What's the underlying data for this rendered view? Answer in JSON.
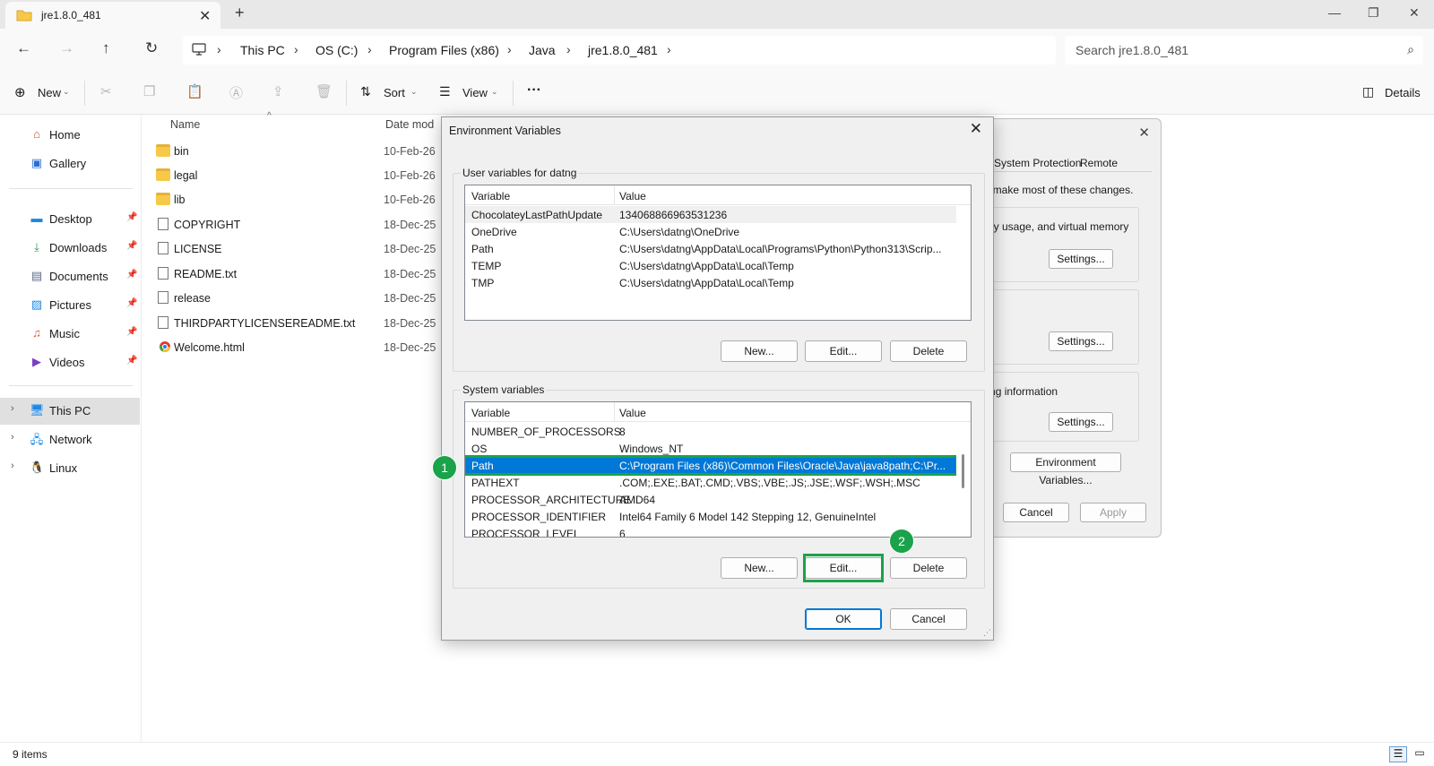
{
  "explorer": {
    "tab_title": "jre1.8.0_481",
    "breadcrumbs": [
      "This PC",
      "OS (C:)",
      "Program Files (x86)",
      "Java",
      "jre1.8.0_481"
    ],
    "search_placeholder": "Search jre1.8.0_481",
    "commands": {
      "new": "New",
      "sort": "Sort",
      "view": "View",
      "more": "···",
      "details": "Details"
    },
    "sidebar": {
      "top": [
        {
          "label": "Home",
          "icon": "home-icon"
        },
        {
          "label": "Gallery",
          "icon": "gallery-icon"
        }
      ],
      "pinned": [
        {
          "label": "Desktop",
          "icon": "desktop-icon"
        },
        {
          "label": "Downloads",
          "icon": "downloads-icon"
        },
        {
          "label": "Documents",
          "icon": "documents-icon"
        },
        {
          "label": "Pictures",
          "icon": "pictures-icon"
        },
        {
          "label": "Music",
          "icon": "music-icon"
        },
        {
          "label": "Videos",
          "icon": "videos-icon"
        }
      ],
      "drives": [
        {
          "label": "This PC",
          "icon": "this-pc-icon"
        },
        {
          "label": "Network",
          "icon": "network-icon"
        },
        {
          "label": "Linux",
          "icon": "linux-icon"
        }
      ]
    },
    "columns": {
      "name": "Name",
      "date": "Date mod"
    },
    "files": [
      {
        "name": "bin",
        "date": "10-Feb-26",
        "type": "folder"
      },
      {
        "name": "legal",
        "date": "10-Feb-26",
        "type": "folder"
      },
      {
        "name": "lib",
        "date": "10-Feb-26",
        "type": "folder"
      },
      {
        "name": "COPYRIGHT",
        "date": "18-Dec-25",
        "type": "file"
      },
      {
        "name": "LICENSE",
        "date": "18-Dec-25",
        "type": "file"
      },
      {
        "name": "README.txt",
        "date": "18-Dec-25",
        "type": "file"
      },
      {
        "name": "release",
        "date": "18-Dec-25",
        "type": "file"
      },
      {
        "name": "THIRDPARTYLICENSEREADME.txt",
        "date": "18-Dec-25",
        "type": "file"
      },
      {
        "name": "Welcome.html",
        "date": "18-Dec-25",
        "type": "html"
      }
    ],
    "status": "9 items"
  },
  "sysprops": {
    "tabs": [
      "System Protection",
      "Remote"
    ],
    "text1": "r to make most of these changes.",
    "text2": "mory usage, and virtual memory",
    "text3": "gging information",
    "settings_label": "Settings...",
    "env_button": "Environment Variables...",
    "cancel": "Cancel",
    "apply": "Apply"
  },
  "envdlg": {
    "title": "Environment Variables",
    "user_group_title": "User variables for datng",
    "system_group_title": "System variables",
    "col_variable": "Variable",
    "col_value": "Value",
    "user_vars": [
      {
        "name": "ChocolateyLastPathUpdate",
        "value": "134068866963531236"
      },
      {
        "name": "OneDrive",
        "value": "C:\\Users\\datng\\OneDrive"
      },
      {
        "name": "Path",
        "value": "C:\\Users\\datng\\AppData\\Local\\Programs\\Python\\Python313\\Scrip..."
      },
      {
        "name": "TEMP",
        "value": "C:\\Users\\datng\\AppData\\Local\\Temp"
      },
      {
        "name": "TMP",
        "value": "C:\\Users\\datng\\AppData\\Local\\Temp"
      }
    ],
    "system_vars": [
      {
        "name": "NUMBER_OF_PROCESSORS",
        "value": "8"
      },
      {
        "name": "OS",
        "value": "Windows_NT"
      },
      {
        "name": "Path",
        "value": "C:\\Program Files (x86)\\Common Files\\Oracle\\Java\\java8path;C:\\Pr..."
      },
      {
        "name": "PATHEXT",
        "value": ".COM;.EXE;.BAT;.CMD;.VBS;.VBE;.JS;.JSE;.WSF;.WSH;.MSC"
      },
      {
        "name": "PROCESSOR_ARCHITECTURE",
        "value": "AMD64"
      },
      {
        "name": "PROCESSOR_IDENTIFIER",
        "value": "Intel64 Family 6 Model 142 Stepping 12, GenuineIntel"
      },
      {
        "name": "PROCESSOR_LEVEL",
        "value": "6"
      }
    ],
    "buttons": {
      "new": "New...",
      "edit": "Edit...",
      "delete": "Delete",
      "ok": "OK",
      "cancel": "Cancel"
    },
    "annotations": [
      "1",
      "2"
    ],
    "highlight_color": "#1aa34a",
    "selection_color": "#0078d7"
  }
}
